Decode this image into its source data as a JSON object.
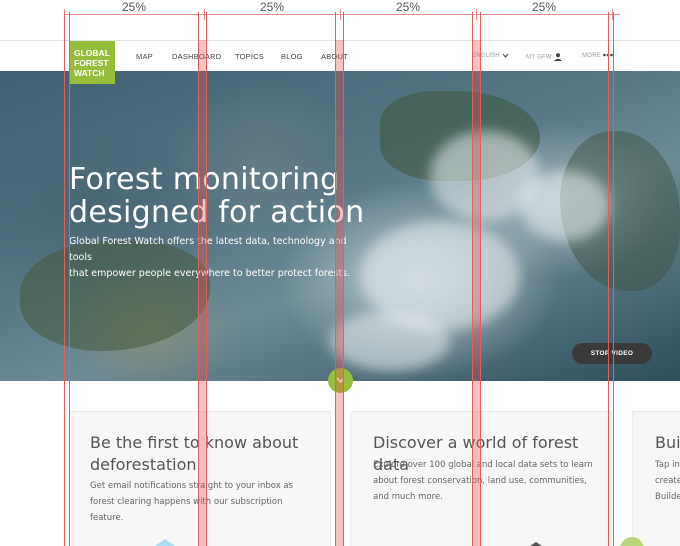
{
  "ruler": {
    "labels": [
      "25%",
      "25%",
      "25%",
      "25%"
    ]
  },
  "logo": {
    "lines": [
      "GLOBAL",
      "FOREST",
      "WATCH"
    ]
  },
  "nav": {
    "items": [
      "MAP",
      "DASHBOARD",
      "TOPICS",
      "BLOG",
      "ABOUT"
    ],
    "language": "ENGLISH",
    "my_gfw": "MY GFW",
    "more": "MORE"
  },
  "hero": {
    "title_line1": "Forest monitoring",
    "title_line2": "designed for action",
    "subtitle_line1": "Global Forest Watch offers the latest data, technology and tools",
    "subtitle_line2": "that empower people everywhere to better protect forests.",
    "stop_video": "STOP VIDEO"
  },
  "cards": [
    {
      "title_line1": "Be the first to know about",
      "title_line2": "deforestation",
      "text": [
        "Get email notifications straight to your inbox as",
        "forest clearing happens with our subscription",
        "feature."
      ]
    },
    {
      "title_line1": "Discover a world of forest data",
      "title_line2": "",
      "text": [
        "Explore over 100 global and local data sets to learn",
        "about forest conservation, land use, communities,",
        "and much more."
      ]
    },
    {
      "title_line1": "Buil",
      "title_line2": "",
      "text": [
        "Tap in",
        "create",
        "Builde"
      ]
    }
  ],
  "colors": {
    "brand_green": "#97bd3d",
    "guide_red": "#e06060"
  }
}
